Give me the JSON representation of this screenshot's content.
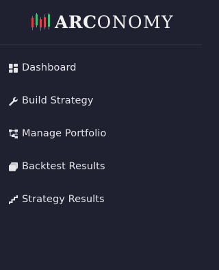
{
  "brand": {
    "name_part1": "ARC",
    "name_part2": "ONOMY",
    "colors": {
      "red": "#d9434b",
      "green": "#3fbf77",
      "text": "#f2f2f2"
    },
    "icon": "candlestick-logo-icon"
  },
  "sidebar": {
    "background": "#1f2130",
    "items": [
      {
        "label": "Dashboard",
        "icon": "dashboard-icon"
      },
      {
        "label": "Build Strategy",
        "icon": "wrench-icon"
      },
      {
        "label": "Manage Portfolio",
        "icon": "hierarchy-icon"
      },
      {
        "label": "Backtest Results",
        "icon": "stack-icon"
      },
      {
        "label": "Strategy Results",
        "icon": "stairs-icon"
      }
    ]
  }
}
